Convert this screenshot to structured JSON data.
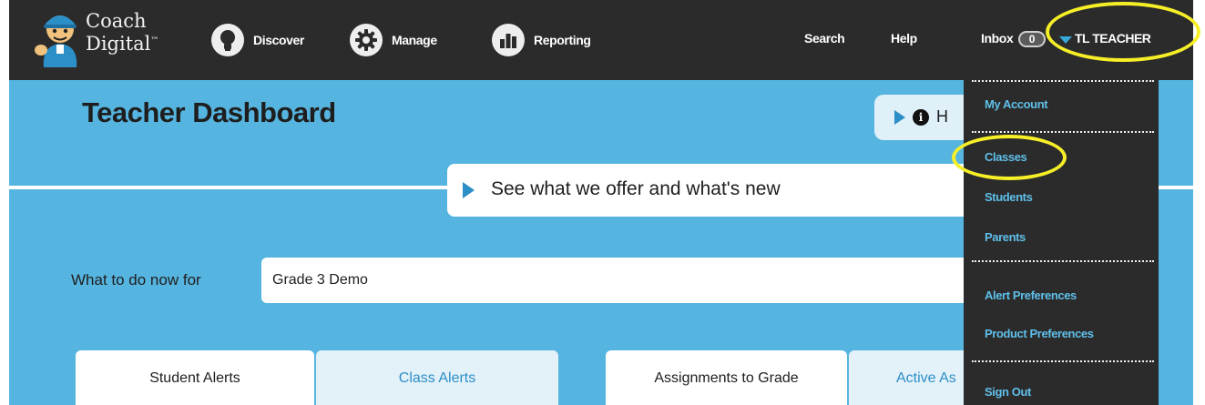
{
  "brand": {
    "line1": "Coach",
    "line2": "Digital",
    "tm": "™"
  },
  "nav": {
    "discover": {
      "label": "Discover",
      "icon": "lightbulb-icon"
    },
    "manage": {
      "label": "Manage",
      "icon": "gear-icon"
    },
    "reporting": {
      "label": "Reporting",
      "icon": "bar-chart-icon"
    }
  },
  "utility": {
    "search": "Search",
    "help": "Help",
    "inbox": "Inbox",
    "inbox_count": "0",
    "user_name": "TL TEACHER"
  },
  "page": {
    "title": "Teacher Dashboard",
    "help_label": "H",
    "whats_new": "See what we offer and what's new",
    "todo_label": "What to do now for",
    "selected_class": "Grade 3 Demo"
  },
  "tabs": [
    {
      "label": "Student Alerts"
    },
    {
      "label": "Class Alerts"
    },
    {
      "label": "Assignments to Grade"
    },
    {
      "label": "Active As"
    }
  ],
  "dropdown": {
    "my_account": "My Account",
    "classes": "Classes",
    "students": "Students",
    "parents": "Parents",
    "alert_preferences": "Alert Preferences",
    "product_preferences": "Product Preferences",
    "sign_out": "Sign Out"
  },
  "colors": {
    "navbar": "#2b2b2b",
    "content_bg": "#56b5e0",
    "link_blue": "#5fbfe9",
    "highlight": "#f6ef28"
  }
}
